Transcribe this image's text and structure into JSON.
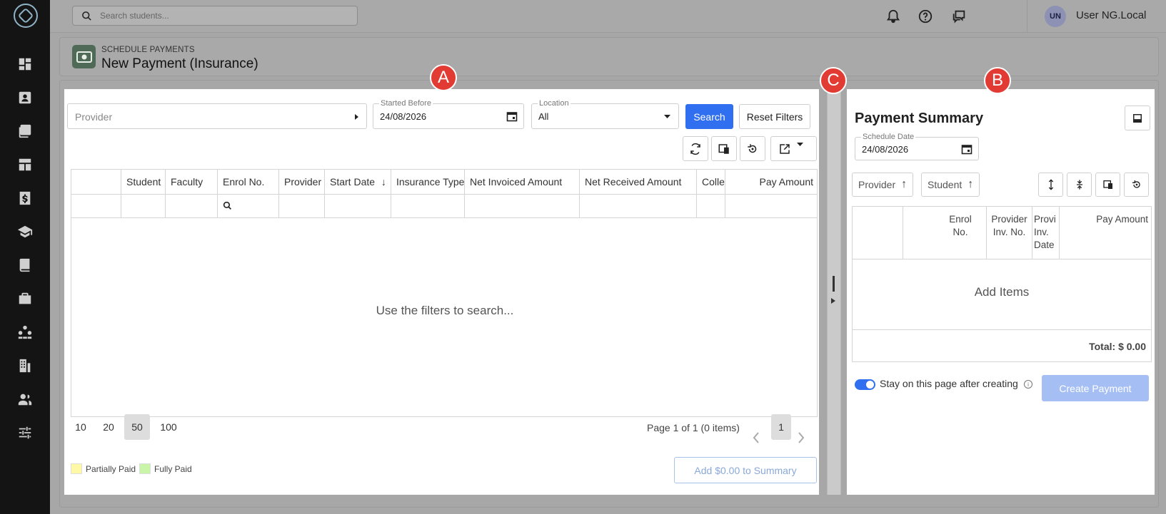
{
  "search": {
    "placeholder": "Search students..."
  },
  "user": {
    "initials": "UN",
    "name": "User NG.Local"
  },
  "header": {
    "subtitle": "SCHEDULE PAYMENTS",
    "title": "New Payment (Insurance)"
  },
  "filters": {
    "provider_placeholder": "Provider",
    "started_before_label": "Started Before",
    "started_before_value": "24/08/2026",
    "location_label": "Location",
    "location_value": "All",
    "search_label": "Search",
    "reset_label": "Reset Filters"
  },
  "grid": {
    "columns": [
      "Student",
      "Faculty",
      "Enrol No.",
      "Provider",
      "Start Date",
      "Insurance Type",
      "Net Invoiced Amount",
      "Net Received Amount",
      "Collec",
      "Pay Amount"
    ],
    "sort_arrow": "↓",
    "empty_message": "Use the filters to search..."
  },
  "pager": {
    "sizes": [
      "10",
      "20",
      "50",
      "100"
    ],
    "active_size": "50",
    "info": "Page 1 of 1 (0 items)",
    "current_page": "1"
  },
  "legend": {
    "partially_paid": "Partially Paid",
    "fully_paid": "Fully Paid",
    "partially_color": "#fdf9a6",
    "fully_color": "#c9f5a8"
  },
  "add_summary_label": "Add $0.00 to Summary",
  "summary": {
    "title": "Payment Summary",
    "schedule_date_label": "Schedule Date",
    "schedule_date_value": "24/08/2026",
    "sort_provider": "Provider",
    "sort_student": "Student",
    "sort_arrow": "↑",
    "columns": [
      "Enrol No.",
      "Provider Inv. No.",
      "Provider Inv. Date",
      "Pay Amount"
    ],
    "col_enrol": [
      "Enrol",
      "No."
    ],
    "col_provinv": [
      "Provider",
      "Inv. No."
    ],
    "col_provdate": [
      "Provi",
      "Inv.",
      "Date"
    ],
    "col_pay": "Pay Amount",
    "empty_message": "Add Items",
    "total": "Total: $ 0.00",
    "stay_label": "Stay on this page after creating",
    "create_label": "Create Payment"
  },
  "badges": {
    "a": "A",
    "b": "B",
    "c": "C"
  },
  "colors": {
    "primary": "#2f6ff0",
    "badge": "#e23b33",
    "nav": "#141414"
  }
}
